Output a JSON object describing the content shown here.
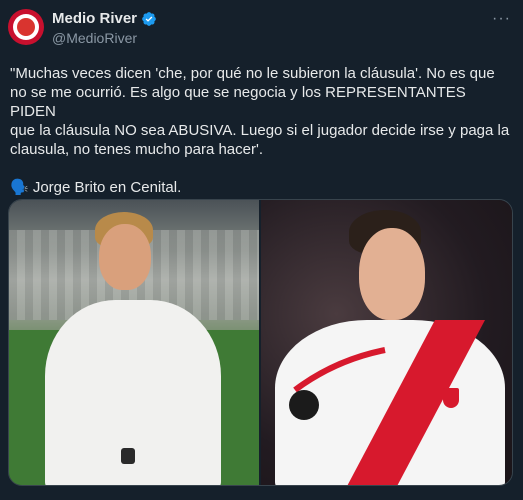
{
  "author": {
    "display_name": "Medio River",
    "handle": "@MedioRiver",
    "verified_icon": "verified-badge-icon",
    "avatar_icon": "river-plate-avatar"
  },
  "menu": {
    "more_icon": "more-horizontal-icon",
    "more_label": "···"
  },
  "tweet": {
    "text": "\"Muchas veces dicen 'che, por qué no le subieron la cláusula'. No es que\nno se me ocurrió. Es algo que se negocia y los REPRESENTANTES PIDEN\nque la cláusula NO sea ABUSIVA. Luego si el jugador decide irse y paga la\nclausula, no tenes mucho para hacer'.\n\n🗣️ Jorge Brito en Cenital."
  },
  "media": {
    "photos": [
      {
        "description_icon": "photo-man-white-shirt"
      },
      {
        "description_icon": "photo-player-river-jersey"
      }
    ]
  },
  "colors": {
    "background": "#15202b",
    "text": "#e7e9ea",
    "secondary": "#8b98a5",
    "verified": "#1d9bf0"
  }
}
